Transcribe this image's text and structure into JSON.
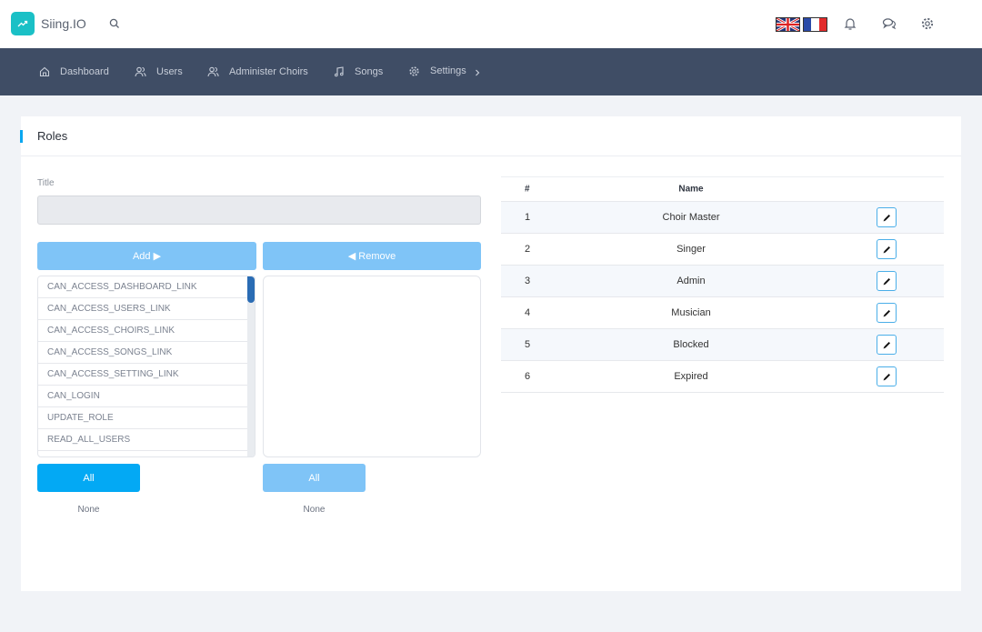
{
  "header": {
    "brand": "Siing.IO",
    "icons": [
      "trend-up-icon",
      "search-icon",
      "flag-uk-icon",
      "flag-fr-icon",
      "bell-icon",
      "chat-icon",
      "gear-icon"
    ],
    "languages": [
      "English",
      "French"
    ]
  },
  "nav": {
    "items": [
      {
        "label": "Dashboard",
        "icon": "home-icon"
      },
      {
        "label": "Users",
        "icon": "users-icon"
      },
      {
        "label": "Administer Choirs",
        "icon": "users-icon"
      },
      {
        "label": "Songs",
        "icon": "music-icon"
      },
      {
        "label": "Settings",
        "icon": "gear-icon"
      }
    ],
    "more_icon": "chevron-right-icon"
  },
  "card": {
    "title": "Roles",
    "form": {
      "title_label": "Title",
      "title_value": "",
      "add_label": "Add ▶",
      "remove_label": "◀ Remove",
      "available_permissions": [
        "CAN_ACCESS_DASHBOARD_LINK",
        "CAN_ACCESS_USERS_LINK",
        "CAN_ACCESS_CHOIRS_LINK",
        "CAN_ACCESS_SONGS_LINK",
        "CAN_ACCESS_SETTING_LINK",
        "CAN_LOGIN",
        "UPDATE_ROLE",
        "READ_ALL_USERS"
      ],
      "selected_permissions": [],
      "all_label_left": "All",
      "none_label_left": "None",
      "all_label_right": "All",
      "none_label_right": "None"
    },
    "table": {
      "headers": [
        "#",
        "Name",
        ""
      ],
      "rows": [
        {
          "num": "1",
          "name": "Choir Master"
        },
        {
          "num": "2",
          "name": "Singer"
        },
        {
          "num": "3",
          "name": "Admin"
        },
        {
          "num": "4",
          "name": "Musician"
        },
        {
          "num": "5",
          "name": "Blocked"
        },
        {
          "num": "6",
          "name": "Expired"
        }
      ]
    }
  },
  "colors": {
    "accent": "#0aa7f0",
    "nav_bg": "#3f4d65",
    "logo": "#1ac0c6",
    "button_light": "#7fc4f7"
  }
}
